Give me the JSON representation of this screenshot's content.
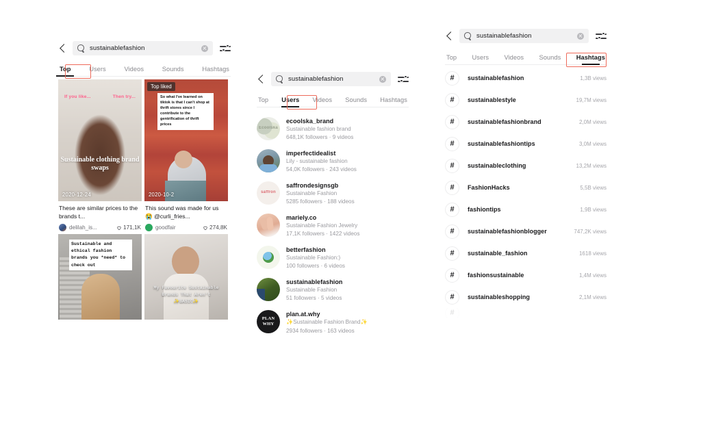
{
  "meta": {
    "app": "TikTok search results",
    "accent_highlight": "#ee6a5a",
    "text_primary": "#19191b",
    "text_muted": "#9a9a9f",
    "searchbar_bg": "#f1f1f2"
  },
  "icons": {
    "back": "back-chevron-icon",
    "search": "magnifier-icon",
    "clear": "clear-circle-icon",
    "filter": "filter-sliders-icon",
    "hashtag": "hashtag-icon",
    "heart": "heart-outline-icon"
  },
  "panels": [
    {
      "id": "top",
      "search": {
        "value": "sustainablefashion",
        "placeholder": "Search"
      },
      "tabs": [
        {
          "label": "Top",
          "active": true,
          "highlighted": true
        },
        {
          "label": "Users",
          "active": false,
          "highlighted": false
        },
        {
          "label": "Videos",
          "active": false,
          "highlighted": false
        },
        {
          "label": "Sounds",
          "active": false,
          "highlighted": false
        },
        {
          "label": "Hashtags",
          "active": false,
          "highlighted": false
        }
      ],
      "videos": [
        {
          "date": "2020-12-24",
          "badge": "",
          "overlay_left": "If you like...",
          "overlay_right": "Then try...",
          "overlay_center": "Sustainable clothing brand swaps",
          "title": "These are similar prices to the brands t...",
          "user": "delilah_is...",
          "likes": "171,1K",
          "avatar_color": "#3f5f96"
        },
        {
          "date": "2020-10-2",
          "badge": "Top liked",
          "card_text": "So what I've learned on tiktok is that I can't shop at thrift stores since I contribute to the gentrification of thrift prices",
          "title": "This sound was made for us 😭 @curli_fries...",
          "user": "goodfair",
          "likes": "274,8K",
          "avatar_color": "#2aa85f"
        },
        {
          "date": "",
          "badge": "",
          "overlay_mono_dark": "Sustainable and ethical fashion brands you *need* to check out",
          "title": "",
          "user": "",
          "likes": "",
          "avatar_color": "#8d8d8d"
        },
        {
          "date": "",
          "badge": "",
          "overlay_mono_light": "My Favourite Sustainable Brands That Aren't ✨BASIC✨",
          "title": "",
          "user": "",
          "likes": "",
          "avatar_color": "#8d8d8d"
        }
      ]
    },
    {
      "id": "users",
      "search": {
        "value": "sustainablefashion",
        "placeholder": "Search"
      },
      "tabs": [
        {
          "label": "Top",
          "active": false,
          "highlighted": false
        },
        {
          "label": "Users",
          "active": true,
          "highlighted": true
        },
        {
          "label": "Videos",
          "active": false,
          "highlighted": false
        },
        {
          "label": "Sounds",
          "active": false,
          "highlighted": false
        },
        {
          "label": "Hashtags",
          "active": false,
          "highlighted": false
        }
      ],
      "users": [
        {
          "name": "ecoolska_brand",
          "desc": "Sustainable fashion brand",
          "stats": "648,1K followers · 9 videos",
          "avatar_label": "Ecoolska",
          "avatar_color": "#cfd3c3"
        },
        {
          "name": "imperfectidealist",
          "desc": "Lily - sustainable fashion",
          "stats": "54,0K followers · 243 videos",
          "avatar_label": "",
          "avatar_color": "#7a95a8"
        },
        {
          "name": "saffrondesignsgb",
          "desc": "Sustainable Fashion",
          "stats": "5285 followers · 188 videos",
          "avatar_label": "saffron",
          "avatar_color": "#efe6e2"
        },
        {
          "name": "mariely.co",
          "desc": "Sustainable Fashion Jewelry",
          "stats": "17,1K followers · 1422 videos",
          "avatar_label": "",
          "avatar_color": "#e6b9a8"
        },
        {
          "name": "betterfashion",
          "desc": "Sustainable Fashion:)",
          "stats": "100 followers · 6 videos",
          "avatar_label": "",
          "avatar_color": "#eef2e6"
        },
        {
          "name": "sustainablefashion",
          "desc": "Sustainable Fashion",
          "stats": "51 followers · 5 videos",
          "avatar_label": "",
          "avatar_color": "#4c6a33"
        },
        {
          "name": "plan.at.why",
          "desc": "✨Sustainable Fashion Brand✨",
          "stats": "2934 followers · 163 videos",
          "avatar_label": "PLAN WHY",
          "avatar_color": "#19191b"
        }
      ]
    },
    {
      "id": "hashtags",
      "search": {
        "value": "sustainablefashion",
        "placeholder": "Search"
      },
      "tabs": [
        {
          "label": "Top",
          "active": false,
          "highlighted": false
        },
        {
          "label": "Users",
          "active": false,
          "highlighted": false
        },
        {
          "label": "Videos",
          "active": false,
          "highlighted": false
        },
        {
          "label": "Sounds",
          "active": false,
          "highlighted": false
        },
        {
          "label": "Hashtags",
          "active": true,
          "highlighted": true
        }
      ],
      "hashtags": [
        {
          "name": "sustainablefashion",
          "views": "1,3B views"
        },
        {
          "name": "sustainablestyle",
          "views": "19,7M views"
        },
        {
          "name": "sustainablefashionbrand",
          "views": "2,0M views"
        },
        {
          "name": "sustainablefashiontips",
          "views": "3,0M views"
        },
        {
          "name": "sustainableclothing",
          "views": "13,2M views"
        },
        {
          "name": "FashionHacks",
          "views": "5,5B views"
        },
        {
          "name": "fashiontips",
          "views": "1,9B views"
        },
        {
          "name": "sustainablefashionblogger",
          "views": "747,2K views"
        },
        {
          "name": "sustainable_fashion",
          "views": "1618 views"
        },
        {
          "name": "fashionsustainable",
          "views": "1,4M views"
        },
        {
          "name": "sustainableshopping",
          "views": "2,1M views"
        }
      ]
    }
  ]
}
